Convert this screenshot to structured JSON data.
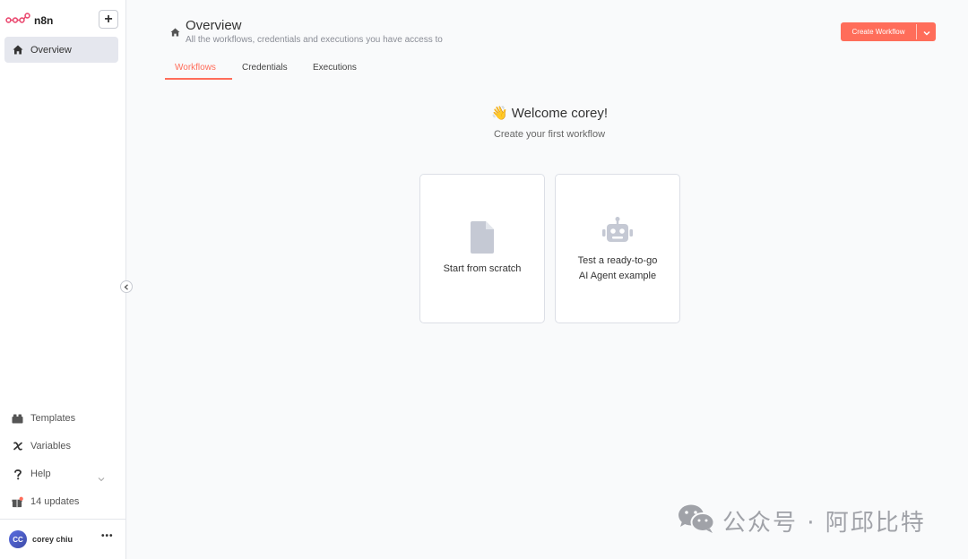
{
  "app": {
    "brand_name": "n8n",
    "accent_color": "#ff6d5a"
  },
  "sidebar": {
    "add_button_label": "+",
    "nav_active": {
      "label": "Overview",
      "icon": "home-icon"
    },
    "bottom_items": [
      {
        "label": "Templates",
        "icon": "templates-icon"
      },
      {
        "label": "Variables",
        "icon": "variables-icon"
      },
      {
        "label": "Help",
        "icon": "help-icon"
      },
      {
        "label": "14 updates",
        "icon": "gift-icon"
      }
    ],
    "user": {
      "initials": "CC",
      "name": "corey chiu",
      "menu_label": "•••"
    }
  },
  "header": {
    "title": "Overview",
    "subtitle": "All the workflows, credentials and executions you have access to",
    "create_button_label": "Create Workflow"
  },
  "tabs": [
    {
      "label": "Workflows",
      "active": true
    },
    {
      "label": "Credentials",
      "active": false
    },
    {
      "label": "Executions",
      "active": false
    }
  ],
  "main": {
    "welcome_emoji": "👋",
    "welcome_title": "Welcome corey!",
    "welcome_subtitle": "Create your first workflow",
    "cards": [
      {
        "label": "Start from scratch",
        "icon": "file-icon"
      },
      {
        "label_line1": "Test a ready-to-go",
        "label_line2": "AI Agent example",
        "icon": "robot-icon"
      }
    ]
  },
  "watermark": {
    "text": "公众号 · 阿邱比特",
    "icon": "wechat-icon"
  }
}
